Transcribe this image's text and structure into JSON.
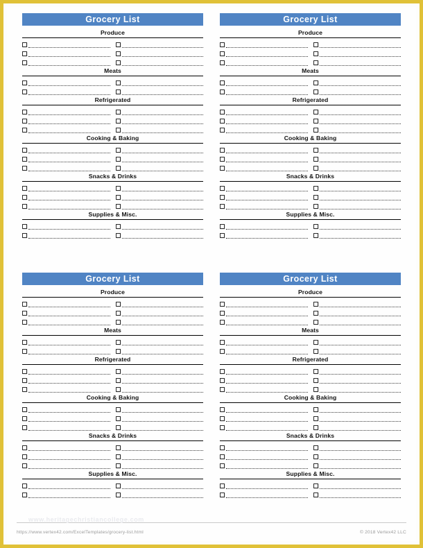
{
  "document": {
    "title": "Grocery List",
    "accent_blue": "#5084c4",
    "border_gold": "#e0c137",
    "watermark": "www.heritagechristiancollege.com"
  },
  "footer": {
    "url": "https://www.vertex42.com/ExcelTemplates/grocery-list.html",
    "copyright": "© 2018 Vertex42 LLC"
  },
  "card": {
    "title": "Grocery List",
    "sections": [
      {
        "name": "Produce",
        "rows": 3
      },
      {
        "name": "Meats",
        "rows": 2
      },
      {
        "name": "Refrigerated",
        "rows": 3
      },
      {
        "name": "Cooking & Baking",
        "rows": 3
      },
      {
        "name": "Snacks & Drinks",
        "rows": 3
      },
      {
        "name": "Supplies & Misc.",
        "rows": 2
      }
    ]
  },
  "layout": {
    "cards": 4,
    "columns": 2,
    "rows": 2,
    "row_columns": 2
  }
}
